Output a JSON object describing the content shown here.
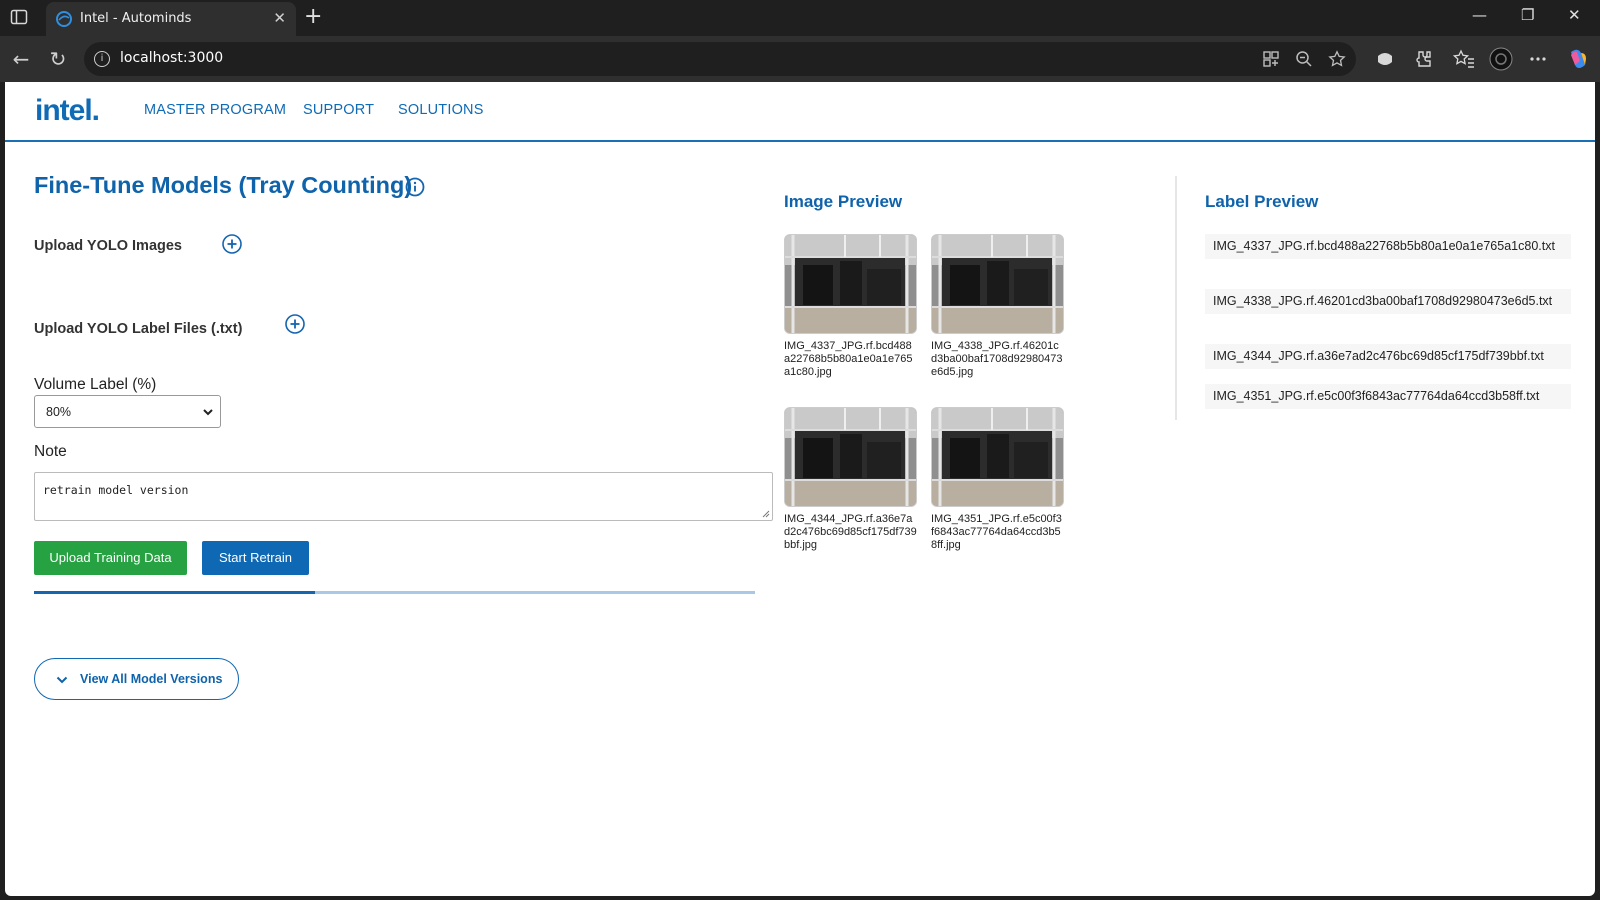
{
  "browser": {
    "tab_title": "Intel - Autominds",
    "url": "localhost:3000"
  },
  "header": {
    "logo_text": "intel.",
    "nav": [
      "MASTER PROGRAM",
      "SUPPORT",
      "SOLUTIONS"
    ]
  },
  "page": {
    "title": "Fine-Tune Models (Tray Counting)",
    "upload_images_label": "Upload YOLO Images",
    "upload_labels_label": "Upload YOLO Label Files (.txt)",
    "volume_label": "Volume Label (%)",
    "volume_value": "80%",
    "note_label": "Note",
    "note_value": "retrain model version",
    "upload_button": "Upload Training Data",
    "retrain_button": "Start Retrain",
    "progress_fraction": 0.39,
    "versions_button": "View All Model Versions"
  },
  "image_preview": {
    "heading": "Image Preview",
    "images": [
      "IMG_4337_JPG.rf.bcd488a22768b5b80a1e0a1e765a1c80.jpg",
      "IMG_4338_JPG.rf.46201cd3ba00baf1708d92980473e6d5.jpg",
      "IMG_4344_JPG.rf.a36e7ad2c476bc69d85cf175df739bbf.jpg",
      "IMG_4351_JPG.rf.e5c00f3f6843ac77764da64ccd3b58ff.jpg"
    ]
  },
  "label_preview": {
    "heading": "Label Preview",
    "files": [
      "IMG_4337_JPG.rf.bcd488a22768b5b80a1e0a1e765a1c80.txt",
      "IMG_4338_JPG.rf.46201cd3ba00baf1708d92980473e6d5.txt",
      "IMG_4344_JPG.rf.a36e7ad2c476bc69d85cf175df739bbf.txt",
      "IMG_4351_JPG.rf.e5c00f3f6843ac77764da64ccd3b58ff.txt"
    ]
  },
  "colors": {
    "brand_blue": "#0f63ab",
    "green_button": "#27a243",
    "blue_button": "#0f68b3"
  }
}
